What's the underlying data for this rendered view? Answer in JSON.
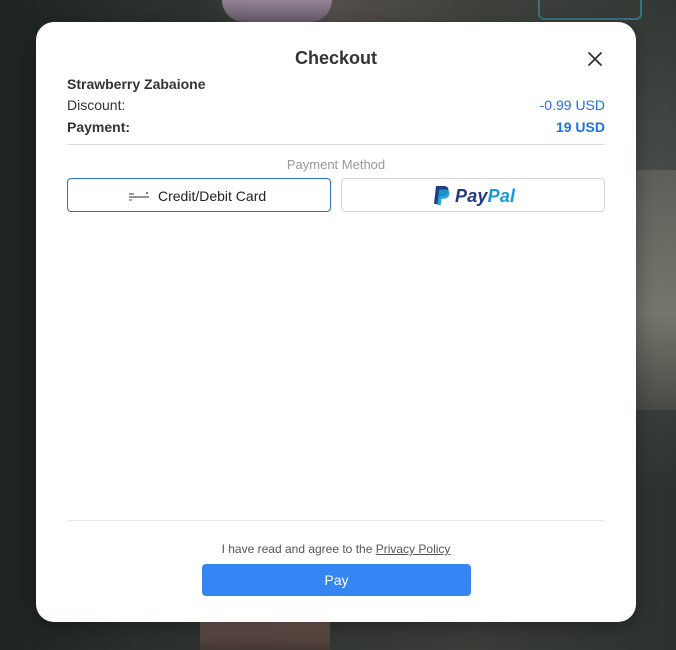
{
  "modal": {
    "title": "Checkout",
    "close_icon": "close-icon"
  },
  "order": {
    "product_name": "Strawberry Zabaione",
    "discount_label": "Discount:",
    "discount_value": "-0.99 USD",
    "payment_label": "Payment:",
    "payment_value": "19 USD"
  },
  "payment_method": {
    "section_label": "Payment Method",
    "options": [
      {
        "label": "Credit/Debit Card",
        "icon": "credit-card-icon",
        "selected": true
      },
      {
        "label_pay": "Pay",
        "label_pal": "Pal",
        "icon": "paypal-logo-icon",
        "selected": false
      }
    ]
  },
  "footer": {
    "agree_prefix": "I have read and agree to the ",
    "privacy_link": "Privacy Policy",
    "pay_button": "Pay"
  },
  "colors": {
    "accent": "#3586f5",
    "selected_border": "#2a6fc9",
    "value_blue": "#1a73e8",
    "paypal_dark": "#253b80",
    "paypal_light": "#179bd7"
  }
}
